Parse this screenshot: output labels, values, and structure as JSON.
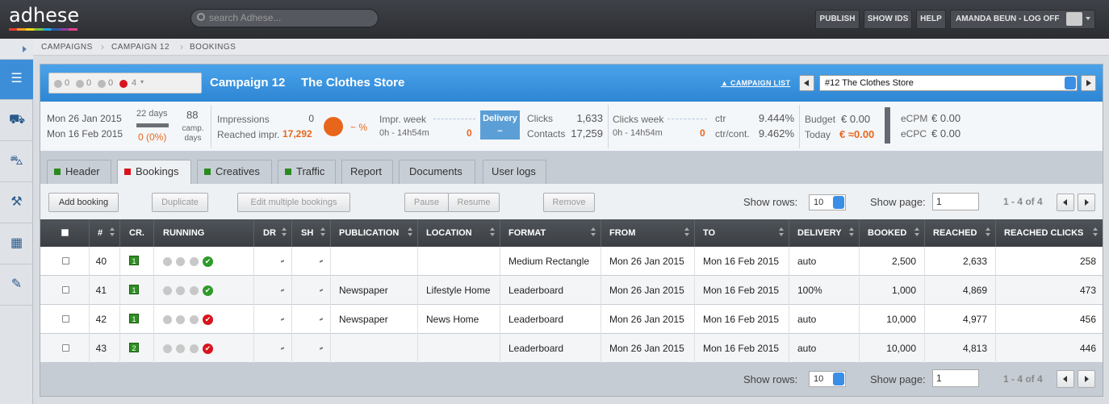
{
  "app": {
    "logo": "adhese"
  },
  "search": {
    "placeholder": "search Adhese..."
  },
  "topnav": {
    "publish": "PUBLISH",
    "show_ids": "SHOW IDS",
    "help": "HELP",
    "user": "AMANDA BEUN - LOG OFF"
  },
  "breadcrumb": [
    "CAMPAIGNS",
    "CAMPAIGN 12",
    "BOOKINGS"
  ],
  "sidebar": {
    "icons": [
      "campaigns-icon",
      "truck-icon",
      "car-icon",
      "tools-icon",
      "calendar-icon",
      "wrench-icon"
    ]
  },
  "campaign": {
    "status_counts": {
      "stopped": "0",
      "running": "0",
      "paused": "0",
      "error": "4"
    },
    "title": "Campaign 12",
    "name": "The Clothes Store",
    "campaign_list": "CAMPAIGN LIST",
    "selector_value": "#12 The Clothes Store"
  },
  "stats": {
    "start_date": "Mon 26 Jan 2015",
    "end_date": "Mon 16 Feb 2015",
    "days": "22 days",
    "days_value": "0 (0%)",
    "camp_days_num": "88",
    "camp_days_label": "camp. days",
    "impressions_label": "Impressions",
    "impressions_value": "0",
    "reached_label": "Reached impr.",
    "reached_value": "17,292",
    "reached_pct": "~ %",
    "impr_week_label": "Impr. week",
    "impr_week_time": "0h - 14h54m",
    "impr_week_value": "0",
    "delivery_label": "Delivery",
    "delivery_value": "~",
    "clicks_label": "Clicks",
    "clicks_value": "1,633",
    "contacts_label": "Contacts",
    "contacts_value": "17,259",
    "clicks_week_label": "Clicks week",
    "clicks_week_time": "0h - 14h54m",
    "clicks_week_value": "0",
    "ctr_label": "ctr",
    "ctr_value": "9.444%",
    "ctr_cont_label": "ctr/cont.",
    "ctr_cont_value": "9.462%",
    "budget_label": "Budget",
    "budget_value": "€ 0.00",
    "today_label": "Today",
    "today_value": "€ ≈0.00",
    "ecpm_label": "eCPM",
    "ecpm_value": "€ 0.00",
    "ecpc_label": "eCPC",
    "ecpc_value": "€ 0.00"
  },
  "tabs": [
    "Header",
    "Bookings",
    "Creatives",
    "Traffic",
    "Report",
    "Documents",
    "User logs"
  ],
  "toolbar": {
    "add_booking": "Add booking",
    "duplicate": "Duplicate",
    "edit_multiple": "Edit multiple bookings",
    "pause": "Pause",
    "resume": "Resume",
    "remove": "Remove",
    "show_rows_label": "Show rows:",
    "show_rows_value": "10",
    "show_page_label": "Show page:",
    "page_value": "1",
    "pager_text": "1 - 4 of 4"
  },
  "table": {
    "headers": [
      "#",
      "CR.",
      "RUNNING",
      "DR",
      "SH",
      "PUBLICATION",
      "LOCATION",
      "FORMAT",
      "FROM",
      "TO",
      "DELIVERY",
      "BOOKED",
      "REACHED",
      "REACHED CLICKS"
    ],
    "rows": [
      {
        "id": "40",
        "cr": "1",
        "status": "ok",
        "publication": "",
        "location": "",
        "format": "Medium Rectangle",
        "from": "Mon 26 Jan 2015",
        "to": "Mon 16 Feb 2015",
        "delivery": "auto",
        "booked": "2,500",
        "reached": "2,633",
        "reached_clicks": "258"
      },
      {
        "id": "41",
        "cr": "1",
        "status": "ok",
        "publication": "Newspaper",
        "location": "Lifestyle Home",
        "format": "Leaderboard",
        "from": "Mon 26 Jan 2015",
        "to": "Mon 16 Feb 2015",
        "delivery": "100%",
        "booked": "1,000",
        "reached": "4,869",
        "reached_clicks": "473"
      },
      {
        "id": "42",
        "cr": "1",
        "status": "error",
        "publication": "Newspaper",
        "location": "News Home",
        "format": "Leaderboard",
        "from": "Mon 26 Jan 2015",
        "to": "Mon 16 Feb 2015",
        "delivery": "auto",
        "booked": "10,000",
        "reached": "4,977",
        "reached_clicks": "456"
      },
      {
        "id": "43",
        "cr": "2",
        "status": "error",
        "publication": "",
        "location": "",
        "format": "Leaderboard",
        "from": "Mon 26 Jan 2015",
        "to": "Mon 16 Feb 2015",
        "delivery": "auto",
        "booked": "10,000",
        "reached": "4,813",
        "reached_clicks": "446"
      }
    ]
  },
  "footer": {
    "show_rows_label": "Show rows:",
    "show_rows_value": "10",
    "show_page_label": "Show page:",
    "page_value": "1",
    "pager_text": "1 - 4 of 4"
  },
  "colors": {
    "accent": "#3d8ed8",
    "warning": "#e8661c",
    "ok": "#2e9a2a",
    "error": "#d8141d"
  }
}
